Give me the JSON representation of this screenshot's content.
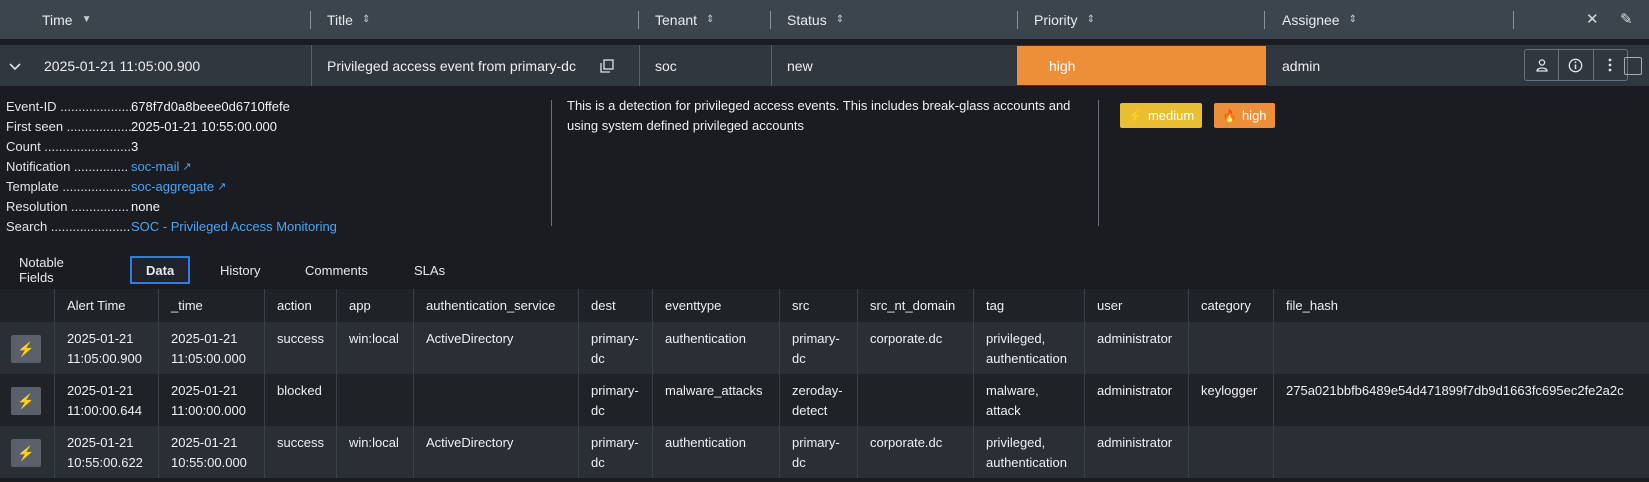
{
  "header": {
    "columns": [
      {
        "label": "Time",
        "sort": "▼"
      },
      {
        "label": "Title",
        "sort": "⇕"
      },
      {
        "label": "Tenant",
        "sort": "⇕"
      },
      {
        "label": "Status",
        "sort": "⇕"
      },
      {
        "label": "Priority",
        "sort": "⇕"
      },
      {
        "label": "Assignee",
        "sort": "⇕"
      }
    ],
    "icons": [
      "close-icon",
      "edit-icon"
    ]
  },
  "alert": {
    "time": "2025-01-21 11:05:00.900",
    "title": "Privileged access event from primary-dc",
    "tenant": "soc",
    "status": "new",
    "priority": "high",
    "assignee": "admin",
    "colors": {
      "priority": "#ec8f38"
    }
  },
  "details": {
    "fields": [
      {
        "key": "Event-ID ....................",
        "value": "678f7d0a8beee0d6710ffefe",
        "link": false
      },
      {
        "key": "First seen ..................",
        "value": "2025-01-21 10:55:00.000",
        "link": false
      },
      {
        "key": "Count ...........................",
        "value": "3",
        "link": false
      },
      {
        "key": "Notification ...............",
        "value": "soc-mail",
        "link": true
      },
      {
        "key": "Template ....................",
        "value": "soc-aggregate",
        "link": true
      },
      {
        "key": "Resolution ................",
        "value": "none",
        "link": false
      },
      {
        "key": "Search .........................",
        "value": "SOC - Privileged Access Monitoring",
        "link": "plain"
      }
    ],
    "description": "This is a detection for privileged access events. This includes break-glass accounts and using system defined privileged accounts",
    "badges": [
      {
        "label": "medium",
        "icon": "bolt-icon",
        "color": "#e8bf30"
      },
      {
        "label": "high",
        "icon": "flame-icon",
        "color": "#ec8f38"
      }
    ]
  },
  "tabs": [
    {
      "label": "Notable Fields",
      "active": false
    },
    {
      "label": "Data",
      "active": true
    },
    {
      "label": "History",
      "active": false
    },
    {
      "label": "Comments",
      "active": false
    },
    {
      "label": "SLAs",
      "active": false
    }
  ],
  "table": {
    "columns": [
      "Alert Time",
      "_time",
      "action",
      "app",
      "authentication_service",
      "dest",
      "eventtype",
      "src",
      "src_nt_domain",
      "tag",
      "user",
      "category",
      "file_hash"
    ],
    "rows": [
      {
        "alert_time": [
          "2025-01-21",
          "11:05:00.900"
        ],
        "time": [
          "2025-01-21",
          "11:05:00.000"
        ],
        "action": "success",
        "app": "win:local",
        "authentication_service": "ActiveDirectory",
        "dest": [
          "primary-",
          "dc"
        ],
        "eventtype": "authentication",
        "src": [
          "primary-",
          "dc"
        ],
        "src_nt_domain": "corporate.dc",
        "tag": [
          "privileged,",
          "authentication"
        ],
        "user": "administrator",
        "category": "",
        "file_hash": ""
      },
      {
        "alert_time": [
          "2025-01-21",
          "11:00:00.644"
        ],
        "time": [
          "2025-01-21",
          "11:00:00.000"
        ],
        "action": "blocked",
        "app": "",
        "authentication_service": "",
        "dest": [
          "primary-",
          "dc"
        ],
        "eventtype": "malware_attacks",
        "src": [
          "zeroday-",
          "detect"
        ],
        "src_nt_domain": "",
        "tag": [
          "malware,",
          "attack"
        ],
        "user": "administrator",
        "category": "keylogger",
        "file_hash": "275a021bbfb6489e54d471899f7db9d1663fc695ec2fe2a2c"
      },
      {
        "alert_time": [
          "2025-01-21",
          "10:55:00.622"
        ],
        "time": [
          "2025-01-21",
          "10:55:00.000"
        ],
        "action": "success",
        "app": "win:local",
        "authentication_service": "ActiveDirectory",
        "dest": [
          "primary-",
          "dc"
        ],
        "eventtype": "authentication",
        "src": [
          "primary-",
          "dc"
        ],
        "src_nt_domain": "corporate.dc",
        "tag": [
          "privileged,",
          "authentication"
        ],
        "user": "administrator",
        "category": "",
        "file_hash": ""
      }
    ]
  }
}
